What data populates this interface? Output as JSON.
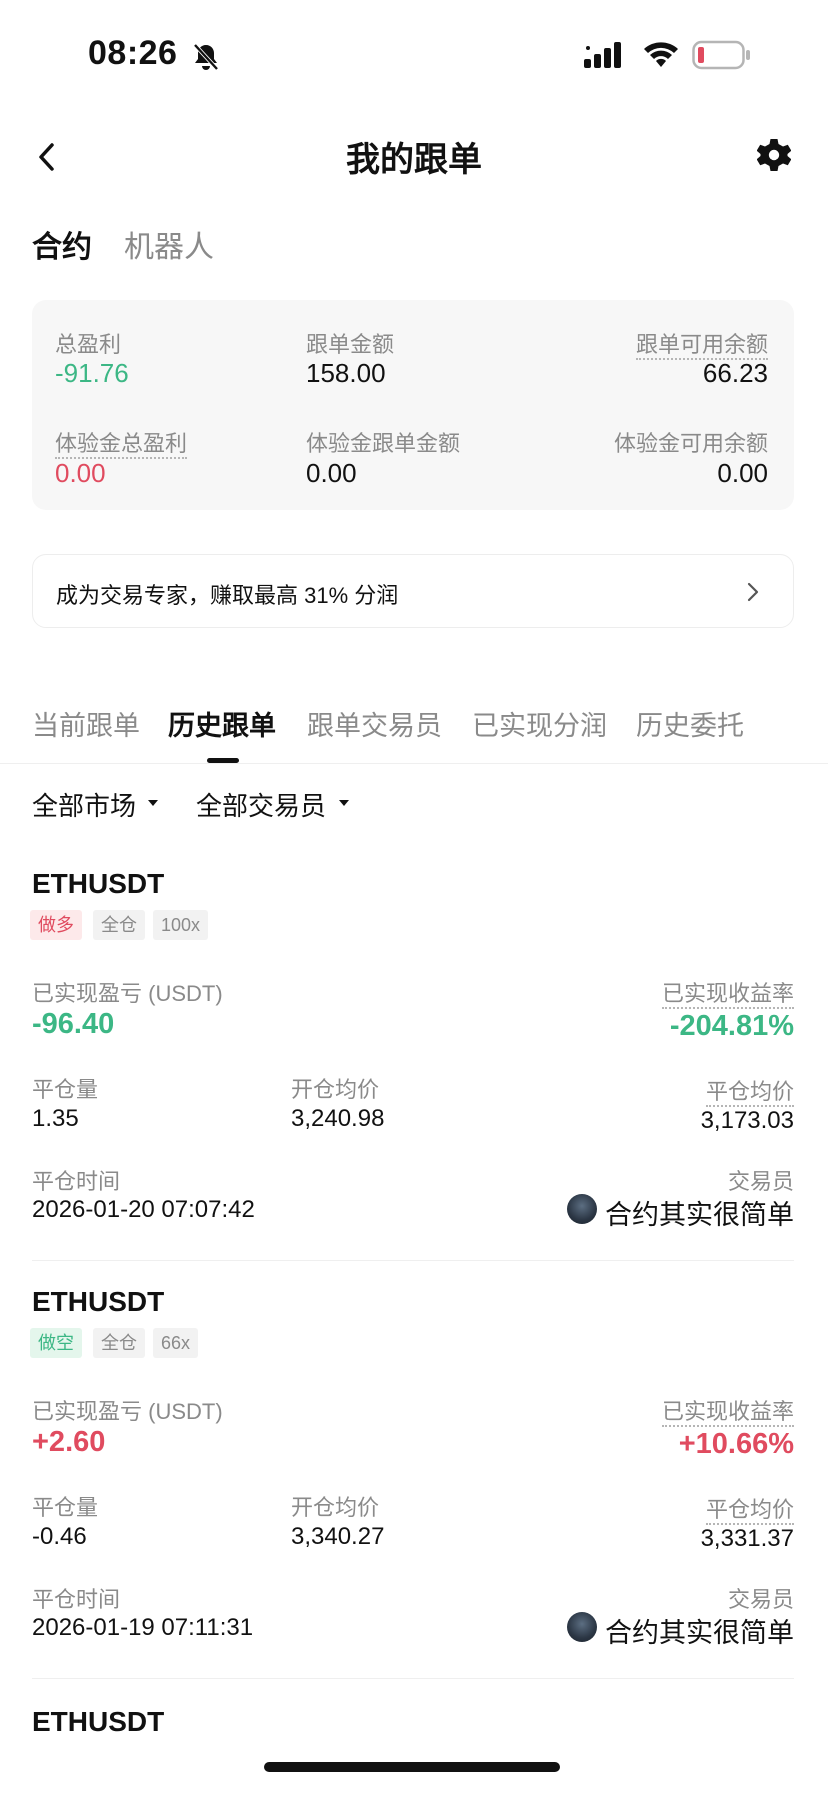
{
  "status_bar": {
    "time": "08:26",
    "battery_color": "#e04b5f"
  },
  "nav": {
    "title": "我的跟单",
    "back_icon": "chevron-left-icon",
    "settings_icon": "gear-icon"
  },
  "type_tabs": [
    "合约",
    "机器人"
  ],
  "summary": {
    "total_pnl_label": "总盈利",
    "total_pnl_value": "-91.76",
    "follow_amount_label": "跟单金额",
    "follow_amount_value": "158.00",
    "available_label": "跟单可用余额",
    "available_value": "66.23",
    "trial_pnl_label": "体验金总盈利",
    "trial_pnl_value": "0.00",
    "trial_amount_label": "体验金跟单金额",
    "trial_amount_value": "0.00",
    "trial_available_label": "体验金可用余额",
    "trial_available_value": "0.00"
  },
  "promo": {
    "text": "成为交易专家，赚取最高 31% 分润"
  },
  "section_tabs": [
    "当前跟单",
    "历史跟单",
    "跟单交易员",
    "已实现分润",
    "历史委托"
  ],
  "filters": {
    "market": "全部市场",
    "trader": "全部交易员"
  },
  "labels": {
    "realized_pnl": "已实现盈亏 (USDT)",
    "realized_rate": "已实现收益率",
    "close_qty": "平仓量",
    "open_avg": "开仓均价",
    "close_avg": "平仓均价",
    "close_time": "平仓时间",
    "trader": "交易员"
  },
  "records": [
    {
      "symbol": "ETHUSDT",
      "side": "做多",
      "margin_mode": "全仓",
      "leverage": "100x",
      "pnl": "-96.40",
      "rate": "-204.81%",
      "close_qty": "1.35",
      "open_avg": "3,240.98",
      "close_avg": "3,173.03",
      "close_time": "2026-01-20 07:07:42",
      "trader_name": "合约其实很简单"
    },
    {
      "symbol": "ETHUSDT",
      "side": "做空",
      "margin_mode": "全仓",
      "leverage": "66x",
      "pnl": "+2.60",
      "rate": "+10.66%",
      "close_qty": "-0.46",
      "open_avg": "3,340.27",
      "close_avg": "3,331.37",
      "close_time": "2026-01-19 07:11:31",
      "trader_name": "合约其实很简单"
    },
    {
      "symbol": "ETHUSDT"
    }
  ]
}
